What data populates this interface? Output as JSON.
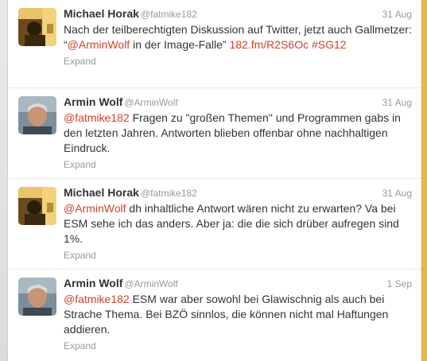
{
  "tweets": [
    {
      "avatar": "michael-horak-avatar",
      "fullname": "Michael Horak",
      "screenname": "@fatmike182",
      "time": "31 Aug",
      "parts": [
        {
          "text": "Nach der teilberechtigten Diskussion auf Twitter, jetzt auch Gallmetzer: “",
          "link": false
        },
        {
          "text": "@ArminWolf",
          "link": true
        },
        {
          "text": " in der Image-Falle” ",
          "link": false
        },
        {
          "text": "182.fm/R2S6Oc",
          "link": true
        },
        {
          "text": " ",
          "link": false
        },
        {
          "text": "#SG12",
          "link": true
        }
      ],
      "expand": "Expand"
    },
    {
      "avatar": "armin-wolf-avatar",
      "fullname": "Armin Wolf",
      "screenname": "@ArminWolf",
      "time": "31 Aug",
      "parts": [
        {
          "text": "@fatmike182",
          "link": true
        },
        {
          "text": " Fragen zu \"großen Themen\" und Programmen gabs in den letzten Jahren. Antworten blieben offenbar ohne nachhaltigen Eindruck.",
          "link": false
        }
      ],
      "expand": "Expand"
    },
    {
      "avatar": "michael-horak-avatar",
      "fullname": "Michael Horak",
      "screenname": "@fatmike182",
      "time": "31 Aug",
      "parts": [
        {
          "text": "@ArminWolf",
          "link": true
        },
        {
          "text": " dh inhaltliche Antwort wären nicht zu erwarten? Va bei ESM sehe ich das anders. Aber ja: die die sich drüber aufregen sind 1%.",
          "link": false
        }
      ],
      "expand": "Expand"
    },
    {
      "avatar": "armin-wolf-avatar",
      "fullname": "Armin Wolf",
      "screenname": "@ArminWolf",
      "time": "1 Sep",
      "parts": [
        {
          "text": "@fatmike182",
          "link": true
        },
        {
          "text": " ESM war aber sowohl bei Glawischnig als auch bei Strache Thema. Bei BZÖ sinnlos, die können nicht mal Haftungen addieren.",
          "link": false
        }
      ],
      "expand": "Expand"
    }
  ]
}
